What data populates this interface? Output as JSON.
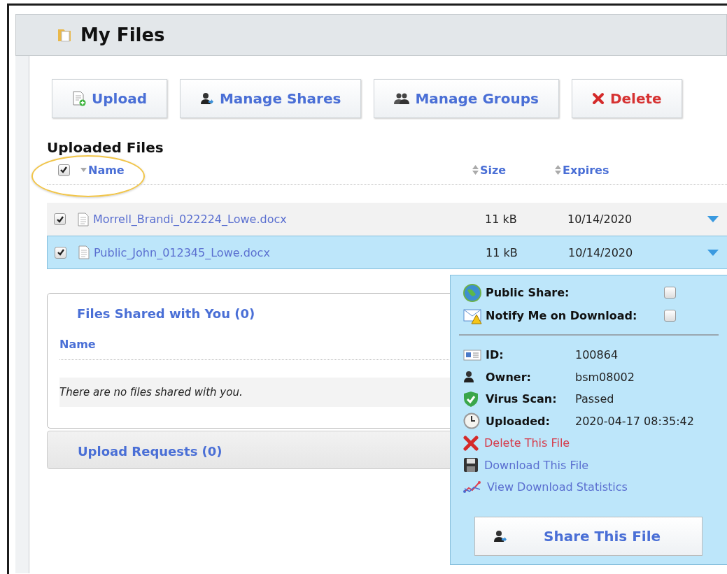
{
  "title": "My Files",
  "toolbar": [
    {
      "label": "Upload",
      "kind": "upload"
    },
    {
      "label": "Manage Shares",
      "kind": "shares"
    },
    {
      "label": "Manage Groups",
      "kind": "groups"
    },
    {
      "label": "Delete",
      "kind": "delete"
    }
  ],
  "uploaded": {
    "heading": "Uploaded Files",
    "select_all_checked": true,
    "columns": [
      {
        "label": "Name",
        "kind": "sorted"
      },
      {
        "label": "Size",
        "kind": "sortable"
      },
      {
        "label": "Expires",
        "kind": "sortable"
      }
    ],
    "rows": [
      {
        "name": "Morrell_Brandi_022224_Lowe.docx",
        "size": "11 kB",
        "expires": "10/14/2020",
        "checked": true,
        "selected": false
      },
      {
        "name": "Public_John_012345_Lowe.docx",
        "size": "11 kB",
        "expires": "10/14/2020",
        "checked": true,
        "selected": true
      }
    ]
  },
  "details": {
    "toggles": [
      {
        "label": "Public Share:",
        "kind": "globe",
        "checked": false
      },
      {
        "label": "Notify Me on Download:",
        "kind": "mail",
        "checked": false
      }
    ],
    "fields": [
      {
        "label": "ID:",
        "value": "100864",
        "kind": "id"
      },
      {
        "label": "Owner:",
        "value": "bsm08002",
        "kind": "owner"
      },
      {
        "label": "Virus Scan:",
        "value": "Passed",
        "kind": "scan"
      },
      {
        "label": "Uploaded:",
        "value": "2020-04-17 08:35:42",
        "kind": "clock"
      }
    ],
    "actions": [
      {
        "label": "Delete This File",
        "kind": "delete"
      },
      {
        "label": "Download This File",
        "kind": "download"
      },
      {
        "label": "View Download Statistics",
        "kind": "stats"
      }
    ],
    "share_button": "Share This File"
  },
  "shared": {
    "title": "Files Shared with You (0)",
    "column": "Name",
    "empty": "There are no files shared with you."
  },
  "requests": {
    "title": "Upload Requests (0)"
  }
}
